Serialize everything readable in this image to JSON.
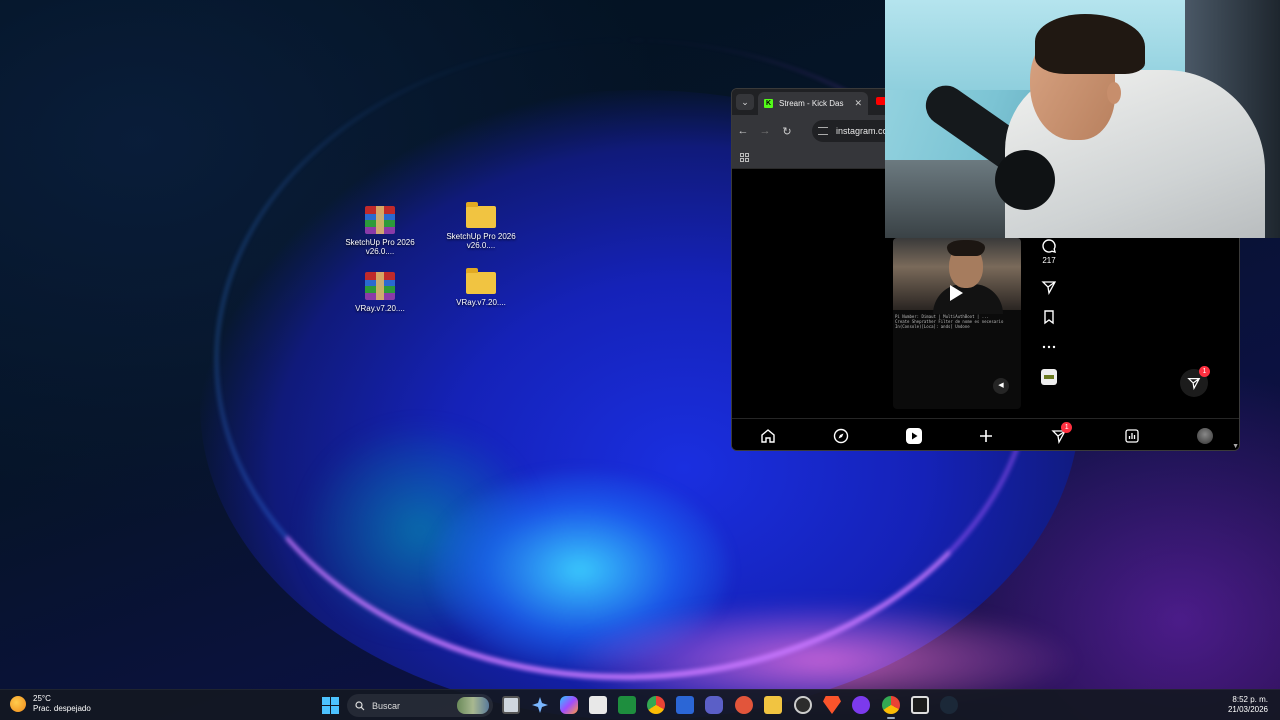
{
  "desktop": {
    "icons": [
      {
        "label": "SketchUp Pro 2026 v26.0....",
        "icon": "winrar-archive-icon"
      },
      {
        "label": "SketchUp Pro 2026 v26.0....",
        "icon": "folder-icon"
      },
      {
        "label": "VRay.v7.20....",
        "icon": "winrar-archive-icon"
      },
      {
        "label": "VRay.v7.20....",
        "icon": "folder-icon"
      }
    ]
  },
  "browser": {
    "tab_title": "Stream - Kick Das",
    "address": "instagram.co",
    "reel": {
      "caption_line1": "Pi Number: Dimaut | MultiAuthBoot | ...",
      "caption_line2": "Create Sheprather   Filter de nome es necesario",
      "caption_line3": "In(Console)[Loca]: ands[ Undone",
      "comment_count": "217"
    },
    "dm_badge": "1",
    "nav_badge": "1"
  },
  "taskbar": {
    "weather_temp": "25°C",
    "weather_desc": "Prac. despejado",
    "search_label": "Buscar",
    "time": "8:52 p. m.",
    "date": "21/03/2026"
  },
  "colors": {
    "kick_green": "#53fc18",
    "badge_red": "#ff3040",
    "start_blue": "#4cc2ff"
  }
}
